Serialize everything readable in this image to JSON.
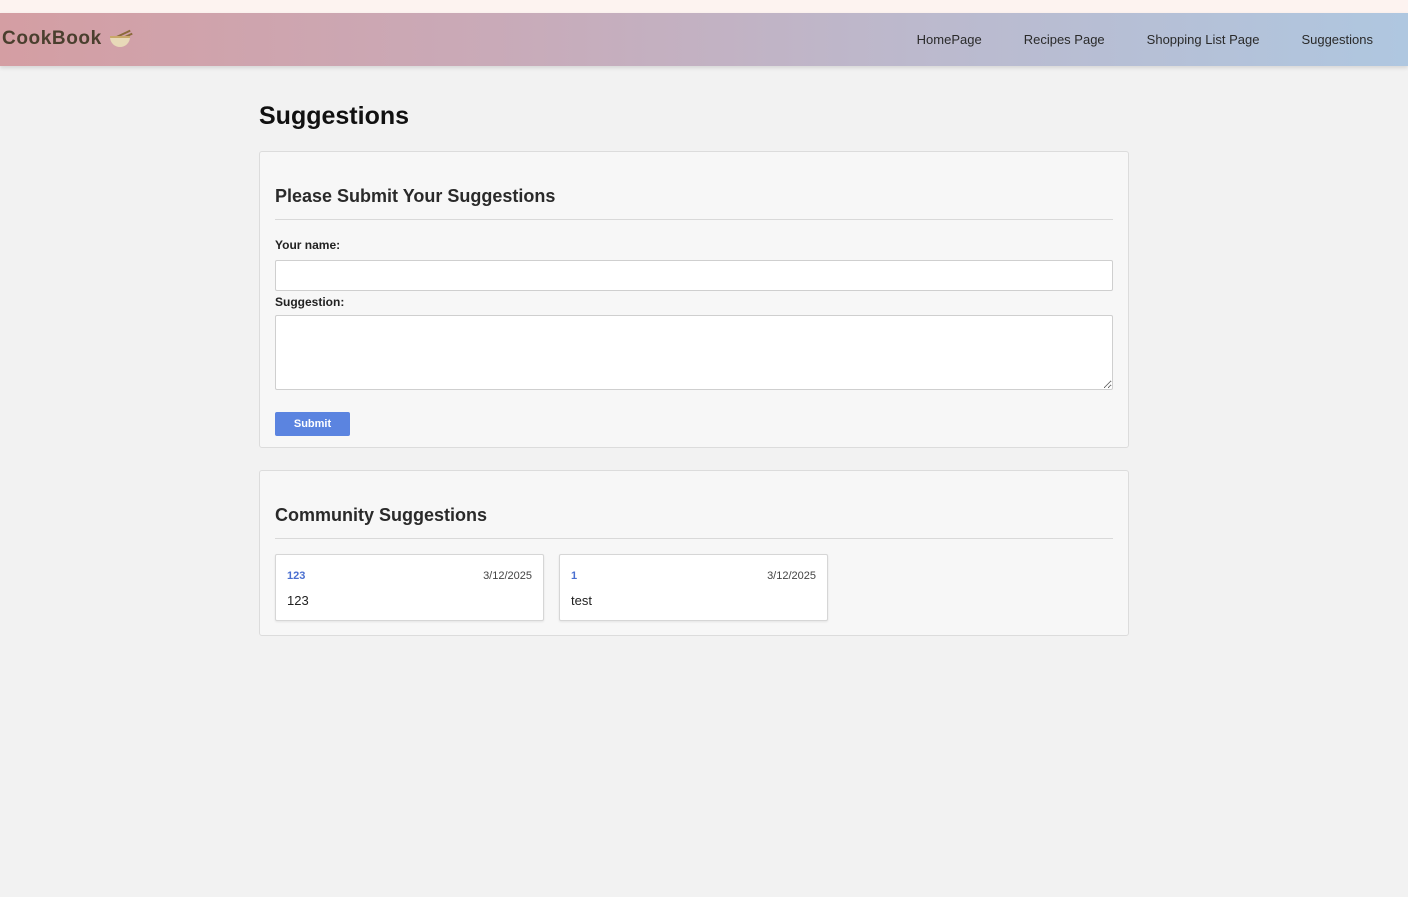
{
  "navbar": {
    "brand": "CookBook",
    "brand_icon": "noodle-bowl-icon",
    "links": [
      {
        "label": "HomePage"
      },
      {
        "label": "Recipes Page"
      },
      {
        "label": "Shopping List Page"
      },
      {
        "label": "Suggestions"
      }
    ]
  },
  "page": {
    "title": "Suggestions"
  },
  "form": {
    "heading": "Please Submit Your Suggestions",
    "name_label": "Your name:",
    "name_value": "",
    "suggestion_label": "Suggestion:",
    "suggestion_value": "",
    "submit_label": "Submit"
  },
  "community": {
    "heading": "Community Suggestions",
    "items": [
      {
        "name": "123",
        "date": "3/12/2025",
        "text": "123"
      },
      {
        "name": "1",
        "date": "3/12/2025",
        "text": "test"
      }
    ]
  },
  "colors": {
    "accent": "#5b84e0",
    "link": "#4a6fd0",
    "nav_gradient_start": "#d49ea3",
    "nav_gradient_end": "#afc7e0"
  }
}
